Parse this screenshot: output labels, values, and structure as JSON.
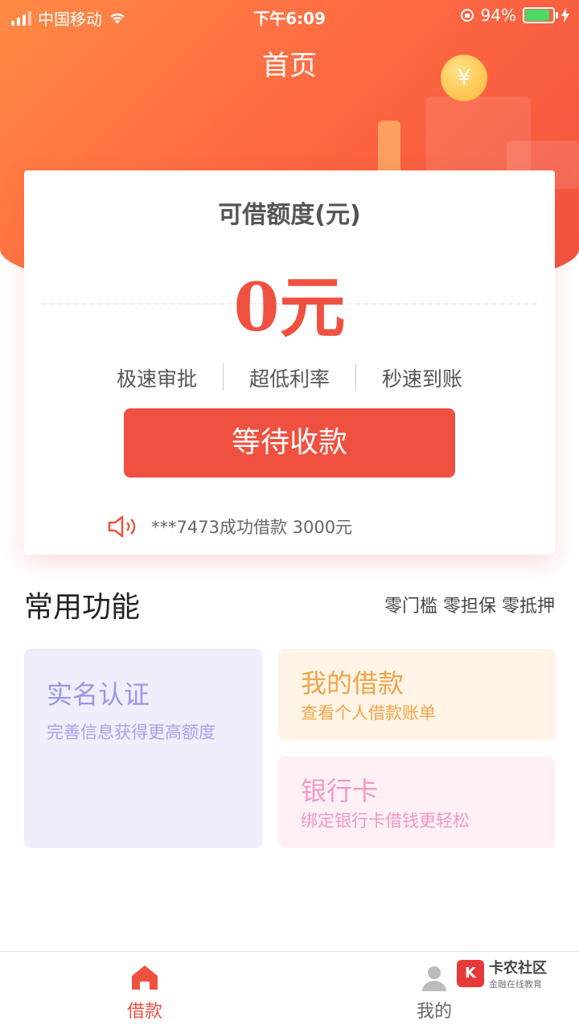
{
  "status_bar": {
    "carrier": "中国移动",
    "time": "下午6:09",
    "battery": "94%"
  },
  "header": {
    "title": "首页"
  },
  "card": {
    "label": "可借额度(元)",
    "amount": "0元",
    "features": [
      "极速审批",
      "超低利率",
      "秒速到账"
    ],
    "button_label": "等待收款",
    "notice": "***7473成功借款 3000元"
  },
  "section": {
    "title": "常用功能",
    "subtitle": "零门槛 零担保 零抵押"
  },
  "tiles": [
    {
      "title": "实名认证",
      "subtitle": "完善信息获得更高额度"
    },
    {
      "title": "我的借款",
      "subtitle": "查看个人借款账单"
    },
    {
      "title": "银行卡",
      "subtitle": "绑定银行卡借钱更轻松"
    }
  ],
  "tabbar": [
    {
      "label": "借款",
      "icon": "home-icon"
    },
    {
      "label": "我的",
      "icon": "user-icon"
    }
  ],
  "watermark": {
    "logo": "K",
    "title": "卡农社区",
    "subtitle": "金融在线教育"
  },
  "colors": {
    "accent": "#f0503f",
    "hero_start": "#ff8a45",
    "hero_end": "#f0503f"
  }
}
